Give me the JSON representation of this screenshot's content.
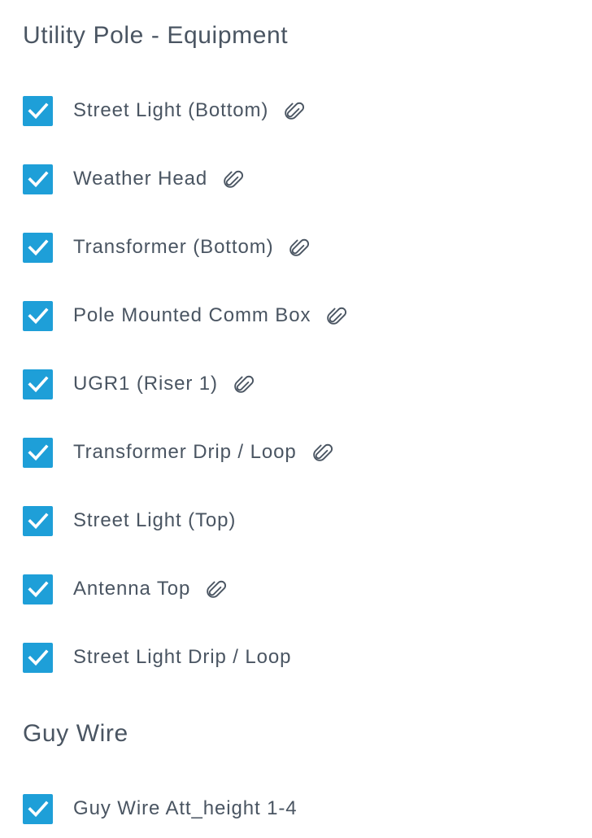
{
  "sections": [
    {
      "title": "Utility Pole - Equipment",
      "items": [
        {
          "label": "Street Light (Bottom)",
          "checked": true,
          "attachment": true
        },
        {
          "label": "Weather Head",
          "checked": true,
          "attachment": true
        },
        {
          "label": "Transformer (Bottom)",
          "checked": true,
          "attachment": true
        },
        {
          "label": "Pole Mounted Comm Box",
          "checked": true,
          "attachment": true
        },
        {
          "label": "UGR1 (Riser 1)",
          "checked": true,
          "attachment": true
        },
        {
          "label": "Transformer Drip / Loop",
          "checked": true,
          "attachment": true
        },
        {
          "label": "Street Light (Top)",
          "checked": true,
          "attachment": false
        },
        {
          "label": "Antenna Top",
          "checked": true,
          "attachment": true
        },
        {
          "label": "Street Light Drip / Loop",
          "checked": true,
          "attachment": false
        }
      ]
    },
    {
      "title": "Guy Wire",
      "items": [
        {
          "label": "Guy Wire Att_height 1-4",
          "checked": true,
          "attachment": false
        }
      ]
    }
  ],
  "icons": {
    "checkbox": "check-icon",
    "attachment": "paperclip-icon"
  },
  "colors": {
    "checkbox_fill": "#1e9fd8",
    "text": "#4a5562"
  }
}
